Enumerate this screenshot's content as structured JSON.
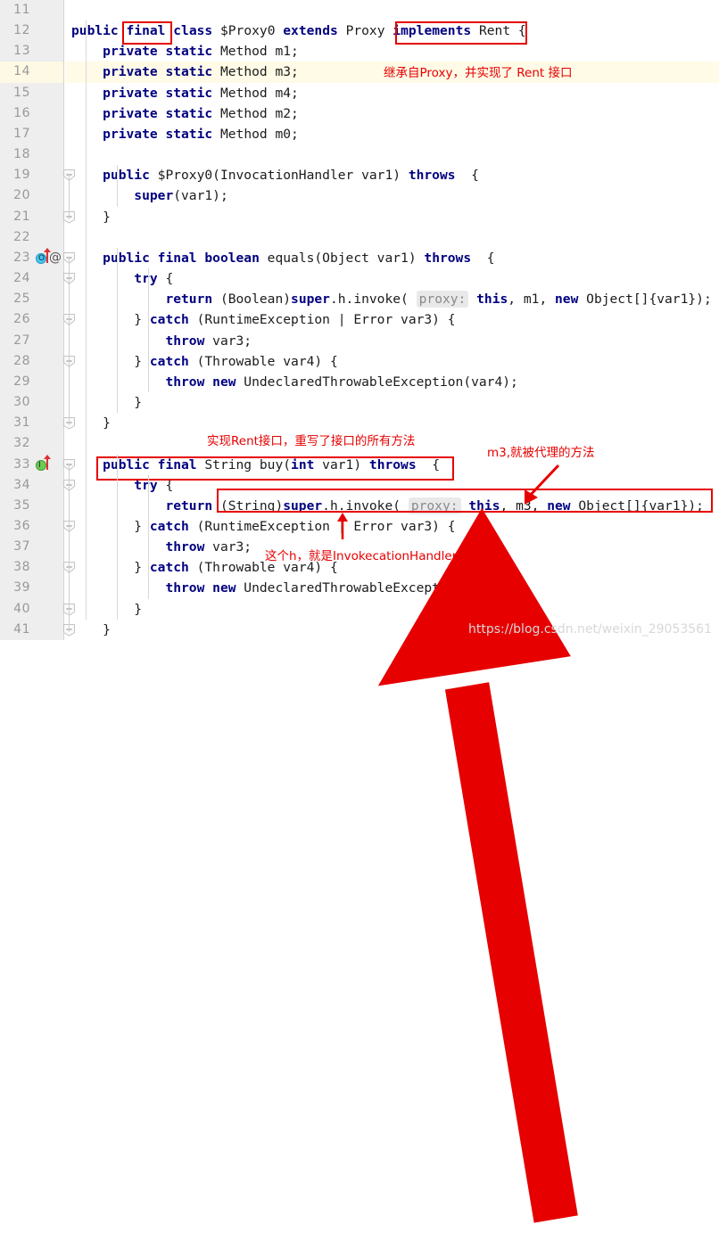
{
  "editor": {
    "first_line": 11,
    "last_line": 41,
    "highlighted_line": 14,
    "colors": {
      "keyword": "#000080",
      "plain": "#1b1b1b",
      "gutter_bg": "#eeeeee",
      "current_line_bg": "#fffbe6",
      "annotation_red": "#e60000",
      "hint_bg": "#e9e9e9",
      "hint_text": "#8a8a8a",
      "override_marker": "#49c7f0",
      "implement_marker": "#6ec956"
    },
    "lines": [
      {
        "no": 11,
        "tokens": []
      },
      {
        "no": 12,
        "tokens": [
          {
            "t": "kw",
            "v": "public"
          },
          {
            "t": "pln",
            "v": " "
          },
          {
            "t": "kw",
            "v": "final"
          },
          {
            "t": "pln",
            "v": " "
          },
          {
            "t": "kw",
            "v": "class"
          },
          {
            "t": "pln",
            "v": " $Proxy0 "
          },
          {
            "t": "kw",
            "v": "extends"
          },
          {
            "t": "pln",
            "v": " Proxy "
          },
          {
            "t": "kw",
            "v": "implements"
          },
          {
            "t": "pln",
            "v": " Rent {"
          }
        ]
      },
      {
        "no": 13,
        "tokens": [
          {
            "t": "pln",
            "v": "    "
          },
          {
            "t": "kw",
            "v": "private static"
          },
          {
            "t": "pln",
            "v": " Method m1;"
          }
        ]
      },
      {
        "no": 14,
        "tokens": [
          {
            "t": "pln",
            "v": "    "
          },
          {
            "t": "kw",
            "v": "private static"
          },
          {
            "t": "pln",
            "v": " Method m3;"
          }
        ]
      },
      {
        "no": 15,
        "tokens": [
          {
            "t": "pln",
            "v": "    "
          },
          {
            "t": "kw",
            "v": "private static"
          },
          {
            "t": "pln",
            "v": " Method m4;"
          }
        ]
      },
      {
        "no": 16,
        "tokens": [
          {
            "t": "pln",
            "v": "    "
          },
          {
            "t": "kw",
            "v": "private static"
          },
          {
            "t": "pln",
            "v": " Method m2;"
          }
        ]
      },
      {
        "no": 17,
        "tokens": [
          {
            "t": "pln",
            "v": "    "
          },
          {
            "t": "kw",
            "v": "private static"
          },
          {
            "t": "pln",
            "v": " Method m0;"
          }
        ]
      },
      {
        "no": 18,
        "tokens": []
      },
      {
        "no": 19,
        "tokens": [
          {
            "t": "pln",
            "v": "    "
          },
          {
            "t": "kw",
            "v": "public"
          },
          {
            "t": "pln",
            "v": " $Proxy0(InvocationHandler var1) "
          },
          {
            "t": "kw",
            "v": "throws"
          },
          {
            "t": "pln",
            "v": "  {"
          }
        ]
      },
      {
        "no": 20,
        "tokens": [
          {
            "t": "pln",
            "v": "        "
          },
          {
            "t": "kw",
            "v": "super"
          },
          {
            "t": "pln",
            "v": "(var1);"
          }
        ]
      },
      {
        "no": 21,
        "tokens": [
          {
            "t": "pln",
            "v": "    }"
          }
        ]
      },
      {
        "no": 22,
        "tokens": []
      },
      {
        "no": 23,
        "tokens": [
          {
            "t": "pln",
            "v": "    "
          },
          {
            "t": "kw",
            "v": "public final boolean"
          },
          {
            "t": "pln",
            "v": " equals(Object var1) "
          },
          {
            "t": "kw",
            "v": "throws"
          },
          {
            "t": "pln",
            "v": "  {"
          }
        ]
      },
      {
        "no": 24,
        "tokens": [
          {
            "t": "pln",
            "v": "        "
          },
          {
            "t": "kw",
            "v": "try"
          },
          {
            "t": "pln",
            "v": " {"
          }
        ]
      },
      {
        "no": 25,
        "tokens": [
          {
            "t": "pln",
            "v": "            "
          },
          {
            "t": "kw",
            "v": "return"
          },
          {
            "t": "pln",
            "v": " (Boolean)"
          },
          {
            "t": "kw",
            "v": "super"
          },
          {
            "t": "pln",
            "v": ".h.invoke( "
          },
          {
            "t": "hint",
            "v": "proxy:"
          },
          {
            "t": "pln",
            "v": " "
          },
          {
            "t": "kw",
            "v": "this"
          },
          {
            "t": "pln",
            "v": ", m1, "
          },
          {
            "t": "kw",
            "v": "new"
          },
          {
            "t": "pln",
            "v": " Object[]{var1});"
          }
        ]
      },
      {
        "no": 26,
        "tokens": [
          {
            "t": "pln",
            "v": "        } "
          },
          {
            "t": "kw",
            "v": "catch"
          },
          {
            "t": "pln",
            "v": " (RuntimeException | Error var3) {"
          }
        ]
      },
      {
        "no": 27,
        "tokens": [
          {
            "t": "pln",
            "v": "            "
          },
          {
            "t": "kw",
            "v": "throw"
          },
          {
            "t": "pln",
            "v": " var3;"
          }
        ]
      },
      {
        "no": 28,
        "tokens": [
          {
            "t": "pln",
            "v": "        } "
          },
          {
            "t": "kw",
            "v": "catch"
          },
          {
            "t": "pln",
            "v": " (Throwable var4) {"
          }
        ]
      },
      {
        "no": 29,
        "tokens": [
          {
            "t": "pln",
            "v": "            "
          },
          {
            "t": "kw",
            "v": "throw new"
          },
          {
            "t": "pln",
            "v": " UndeclaredThrowableException(var4);"
          }
        ]
      },
      {
        "no": 30,
        "tokens": [
          {
            "t": "pln",
            "v": "        }"
          }
        ]
      },
      {
        "no": 31,
        "tokens": [
          {
            "t": "pln",
            "v": "    }"
          }
        ]
      },
      {
        "no": 32,
        "tokens": []
      },
      {
        "no": 33,
        "tokens": [
          {
            "t": "pln",
            "v": "    "
          },
          {
            "t": "kw",
            "v": "public final"
          },
          {
            "t": "pln",
            "v": " String buy("
          },
          {
            "t": "kw",
            "v": "int"
          },
          {
            "t": "pln",
            "v": " var1) "
          },
          {
            "t": "kw",
            "v": "throws"
          },
          {
            "t": "pln",
            "v": "  {"
          }
        ]
      },
      {
        "no": 34,
        "tokens": [
          {
            "t": "pln",
            "v": "        "
          },
          {
            "t": "kw",
            "v": "try"
          },
          {
            "t": "pln",
            "v": " {"
          }
        ]
      },
      {
        "no": 35,
        "tokens": [
          {
            "t": "pln",
            "v": "            "
          },
          {
            "t": "kw",
            "v": "return"
          },
          {
            "t": "pln",
            "v": " (String)"
          },
          {
            "t": "kw",
            "v": "super"
          },
          {
            "t": "pln",
            "v": ".h.invoke( "
          },
          {
            "t": "hint",
            "v": "proxy:"
          },
          {
            "t": "pln",
            "v": " "
          },
          {
            "t": "kw",
            "v": "this"
          },
          {
            "t": "pln",
            "v": ", m3, "
          },
          {
            "t": "kw",
            "v": "new"
          },
          {
            "t": "pln",
            "v": " Object[]{var1});"
          }
        ]
      },
      {
        "no": 36,
        "tokens": [
          {
            "t": "pln",
            "v": "        } "
          },
          {
            "t": "kw",
            "v": "catch"
          },
          {
            "t": "pln",
            "v": " (RuntimeException | Error var3) {"
          }
        ]
      },
      {
        "no": 37,
        "tokens": [
          {
            "t": "pln",
            "v": "            "
          },
          {
            "t": "kw",
            "v": "throw"
          },
          {
            "t": "pln",
            "v": " var3;"
          }
        ]
      },
      {
        "no": 38,
        "tokens": [
          {
            "t": "pln",
            "v": "        } "
          },
          {
            "t": "kw",
            "v": "catch"
          },
          {
            "t": "pln",
            "v": " (Throwable var4) {"
          }
        ]
      },
      {
        "no": 39,
        "tokens": [
          {
            "t": "pln",
            "v": "            "
          },
          {
            "t": "kw",
            "v": "throw new"
          },
          {
            "t": "pln",
            "v": " UndeclaredThrowableException(var4);"
          }
        ]
      },
      {
        "no": 40,
        "tokens": [
          {
            "t": "pln",
            "v": "        }"
          }
        ]
      },
      {
        "no": 41,
        "tokens": [
          {
            "t": "pln",
            "v": "    }"
          }
        ]
      }
    ],
    "gutter_markers": [
      {
        "line": 23,
        "type": "override-marker",
        "glyph": "O",
        "has_arrow": true,
        "annotation": "@"
      },
      {
        "line": 33,
        "type": "implement-marker",
        "glyph": "I",
        "has_arrow": true,
        "annotation": ""
      }
    ],
    "fold_markers": [
      {
        "line": 19,
        "state": "expanded"
      },
      {
        "line": 21,
        "state": "collapsed-end"
      },
      {
        "line": 23,
        "state": "expanded"
      },
      {
        "line": 24,
        "state": "expanded"
      },
      {
        "line": 26,
        "state": "expanded"
      },
      {
        "line": 28,
        "state": "expanded"
      },
      {
        "line": 31,
        "state": "collapsed-end"
      },
      {
        "line": 33,
        "state": "expanded"
      },
      {
        "line": 34,
        "state": "expanded"
      },
      {
        "line": 36,
        "state": "expanded"
      },
      {
        "line": 38,
        "state": "expanded"
      },
      {
        "line": 40,
        "state": "collapsed-end"
      },
      {
        "line": 41,
        "state": "collapsed-end"
      }
    ]
  },
  "annotations": {
    "note_extends": "继承自Proxy，并实现了 Rent 接口",
    "note_implements_rent": "实现Rent接口，重写了接口的所有方法",
    "note_m3": "m3,就被代理的方法",
    "note_h": "这个h，就是InvokecationHandler"
  },
  "watermark": "https://blog.csdn.net/weixin_29053561"
}
